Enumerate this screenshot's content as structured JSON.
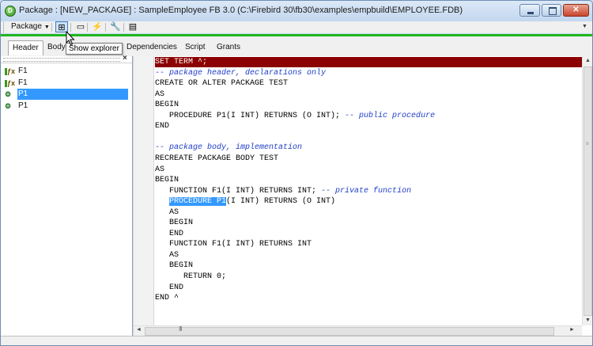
{
  "window": {
    "title": "Package : [NEW_PACKAGE] : SampleEmployee FB 3.0 (C:\\Firebird 30\\fb30\\examples\\empbuild\\EMPLOYEE.FDB)",
    "app_icon_letter": "D",
    "minimize_icon": "minimize-icon",
    "maximize_icon": "maximize-icon",
    "close_glyph": "✕"
  },
  "toolbar": {
    "package_dropdown": "Package",
    "buttons": [
      {
        "icon": "explorer-icon",
        "glyph": "⊞",
        "active": true
      },
      {
        "icon": "object-icon",
        "glyph": "▭"
      },
      {
        "icon": "compile-lightning-icon",
        "glyph": "⚡"
      },
      {
        "icon": "tools-icon",
        "glyph": "🔧"
      },
      {
        "icon": "document-icon",
        "glyph": "▤"
      }
    ],
    "overflow": "▼",
    "accent_color": "#1fb81f"
  },
  "tabs": [
    "Header",
    "Body",
    "Dependencies",
    "Script",
    "Grants"
  ],
  "selected_tab": "Header",
  "tooltip": "Show explorer",
  "explorer": {
    "close_glyph": "×",
    "items": [
      {
        "label": "F1",
        "icon": "function-icon",
        "glyph": "ƒx",
        "selected": false
      },
      {
        "label": "F1",
        "icon": "function-icon",
        "glyph": "ƒx",
        "selected": false
      },
      {
        "label": "P1",
        "icon": "procedure-icon",
        "glyph": "⚙",
        "selected": true
      },
      {
        "label": "P1",
        "icon": "procedure-icon",
        "glyph": "⚙",
        "selected": false
      }
    ]
  },
  "editor": {
    "highlight_color": "#8b0000",
    "comment_color": "#1e3cc8",
    "lines": [
      {
        "code": "SET TERM ^;",
        "highlight": true
      },
      {
        "comment": "-- package header, declarations only"
      },
      {
        "code": "CREATE OR ALTER PACKAGE TEST"
      },
      {
        "code": "AS"
      },
      {
        "code": "BEGIN"
      },
      {
        "code": "   PROCEDURE P1(I INT) RETURNS (O INT); ",
        "comment": "-- public procedure"
      },
      {
        "code": "END"
      },
      {
        "code": ""
      },
      {
        "comment": "-- package body, implementation"
      },
      {
        "code": "RECREATE PACKAGE BODY TEST"
      },
      {
        "code": "AS"
      },
      {
        "code": "BEGIN"
      },
      {
        "code": "   FUNCTION F1(I INT) RETURNS INT; ",
        "comment": "-- private function"
      },
      {
        "code": "   ",
        "selected": "PROCEDURE P1",
        "rest": "(I INT) RETURNS (O INT)"
      },
      {
        "code": "   AS"
      },
      {
        "code": "   BEGIN"
      },
      {
        "code": "   END"
      },
      {
        "code": "   FUNCTION F1(I INT) RETURNS INT"
      },
      {
        "code": "   AS"
      },
      {
        "code": "   BEGIN"
      },
      {
        "code": "      RETURN 0;"
      },
      {
        "code": "   END"
      },
      {
        "code": "END ^"
      }
    ],
    "vscroll_up": "▲",
    "vscroll_down": "▼",
    "vscroll_grip": "≡",
    "hscroll_left": "◄",
    "hscroll_right": "►",
    "hscroll_grip": "III"
  }
}
